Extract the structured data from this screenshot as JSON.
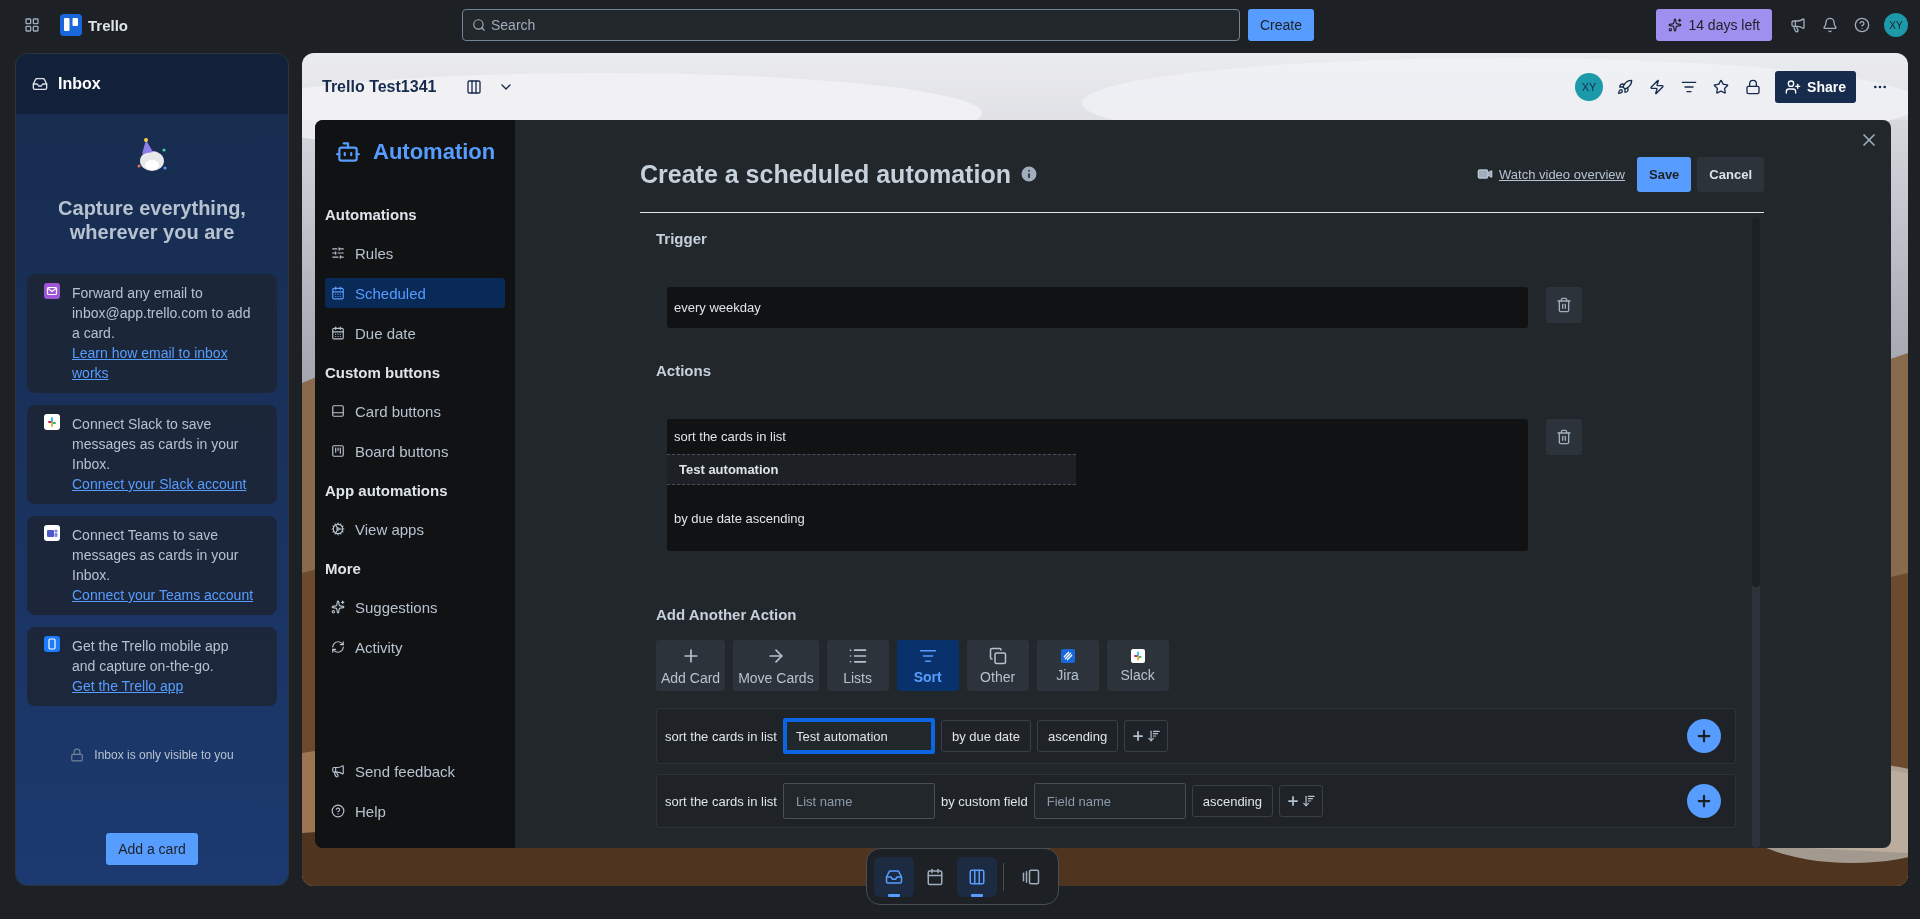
{
  "top_bar": {
    "app_name": "Trello",
    "search_placeholder": "Search",
    "create_button": "Create",
    "trial_badge": "14 days left",
    "avatar": "XY"
  },
  "inbox": {
    "title": "Inbox",
    "heading": "Capture everything, wherever you are",
    "cards": [
      {
        "text": "Forward any email to inbox@app.trello.com to add a card.",
        "link": "Learn how email to inbox works"
      },
      {
        "text": "Connect Slack to save messages as cards in your Inbox.",
        "link": "Connect your Slack account"
      },
      {
        "text": "Connect Teams to save messages as cards in your Inbox.",
        "link": "Connect your Teams account"
      },
      {
        "text": "Get the Trello mobile app and capture on-the-go.",
        "link": "Get the Trello app"
      }
    ],
    "privacy_note": "Inbox is only visible to you",
    "add_button": "Add a card"
  },
  "board": {
    "title": "Trello Test1341",
    "avatar": "XY",
    "share_button": "Share"
  },
  "automation": {
    "title": "Automation",
    "sections": [
      {
        "heading": "Automations",
        "items": [
          {
            "label": "Rules",
            "selected": false
          },
          {
            "label": "Scheduled",
            "selected": true
          },
          {
            "label": "Due date",
            "selected": false
          }
        ]
      },
      {
        "heading": "Custom buttons",
        "items": [
          {
            "label": "Card buttons",
            "selected": false
          },
          {
            "label": "Board buttons",
            "selected": false
          }
        ]
      },
      {
        "heading": "App automations",
        "items": [
          {
            "label": "View apps",
            "selected": false
          }
        ]
      },
      {
        "heading": "More",
        "items": [
          {
            "label": "Suggestions",
            "selected": false
          },
          {
            "label": "Activity",
            "selected": false
          }
        ]
      }
    ],
    "footer_items": [
      {
        "label": "Send feedback"
      },
      {
        "label": "Help"
      }
    ]
  },
  "editor": {
    "title": "Create a scheduled automation",
    "watch_link": "Watch video overview",
    "save_button": "Save",
    "cancel_button": "Cancel",
    "trigger_heading": "Trigger",
    "trigger": "every weekday",
    "actions_heading": "Actions",
    "action": {
      "lead": "sort the cards in list",
      "list_name": "Test automation",
      "tail": "by due date ascending"
    },
    "add_heading": "Add Another Action",
    "action_types": [
      {
        "label": "Add Card",
        "selected": false
      },
      {
        "label": "Move Cards",
        "selected": false
      },
      {
        "label": "Lists",
        "selected": false
      },
      {
        "label": "Sort",
        "selected": true
      },
      {
        "label": "Other",
        "selected": false
      },
      {
        "label": "Jira",
        "selected": false
      },
      {
        "label": "Slack",
        "selected": false
      }
    ],
    "rule_rows": [
      {
        "parts": [
          {
            "kind": "text",
            "text": "sort the cards in list"
          },
          {
            "kind": "field",
            "value": "Test automation",
            "focused": true
          },
          {
            "kind": "chip",
            "text": "by due date"
          },
          {
            "kind": "chip",
            "text": "ascending"
          },
          {
            "kind": "sort_toggle"
          }
        ]
      },
      {
        "parts": [
          {
            "kind": "text",
            "text": "sort the cards in list"
          },
          {
            "kind": "field",
            "placeholder": "List name",
            "focused": false
          },
          {
            "kind": "text",
            "text": "by custom field"
          },
          {
            "kind": "field",
            "placeholder": "Field name",
            "focused": false
          },
          {
            "kind": "chip",
            "text": "ascending"
          },
          {
            "kind": "sort_toggle"
          }
        ]
      }
    ]
  },
  "dock": {
    "items": [
      {
        "selected": true
      },
      {
        "selected": false
      },
      {
        "selected": true
      },
      {
        "selected": false
      }
    ]
  }
}
